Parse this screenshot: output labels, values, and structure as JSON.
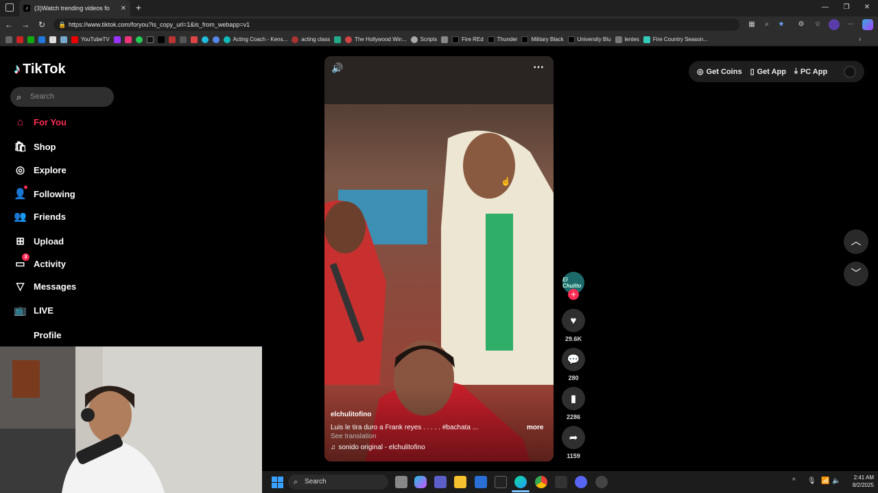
{
  "browser": {
    "tab_title": "(3)Watch trending videos fo",
    "url": "https://www.tiktok.com/foryou?is_copy_url=1&is_from_webapp=v1",
    "bookmarks": [
      "YouTubeTV",
      "Acting Coach - Kens...",
      "acting class",
      "The Hollywood Win...",
      "Scripts",
      "Fire REd",
      "Thunder",
      "Military Black",
      "University Blu",
      "lentes",
      "Fire Country Season..."
    ]
  },
  "tiktok": {
    "logo": "TikTok",
    "search_placeholder": "Search",
    "nav": [
      {
        "label": "For You",
        "icon": "home-icon"
      },
      {
        "label": "Shop",
        "icon": "shop-icon"
      },
      {
        "label": "Explore",
        "icon": "compass-icon"
      },
      {
        "label": "Following",
        "icon": "following-icon"
      },
      {
        "label": "Friends",
        "icon": "friends-icon"
      },
      {
        "label": "Upload",
        "icon": "upload-icon"
      },
      {
        "label": "Activity",
        "icon": "activity-icon",
        "badge": "3"
      },
      {
        "label": "Messages",
        "icon": "messages-icon"
      },
      {
        "label": "LIVE",
        "icon": "live-icon"
      },
      {
        "label": "Profile",
        "icon": "profile-icon"
      }
    ],
    "top_actions": {
      "coins": "Get Coins",
      "app": "Get App",
      "pc": "PC App"
    },
    "video": {
      "username": "elchulitofino",
      "caption": "Luis le tira duro a Frank reyes  . . .  . . #bachata  ...",
      "more": "more",
      "see_translation": "See translation",
      "sound": "sonido original - elchulitofino",
      "avatar_text": "El Chulito"
    },
    "rail": {
      "likes": "29.6K",
      "comments": "280",
      "saves": "2286",
      "shares": "1159"
    }
  },
  "taskbar": {
    "search": "Search",
    "time": "2:41 AM",
    "date": "8/2/2025"
  }
}
